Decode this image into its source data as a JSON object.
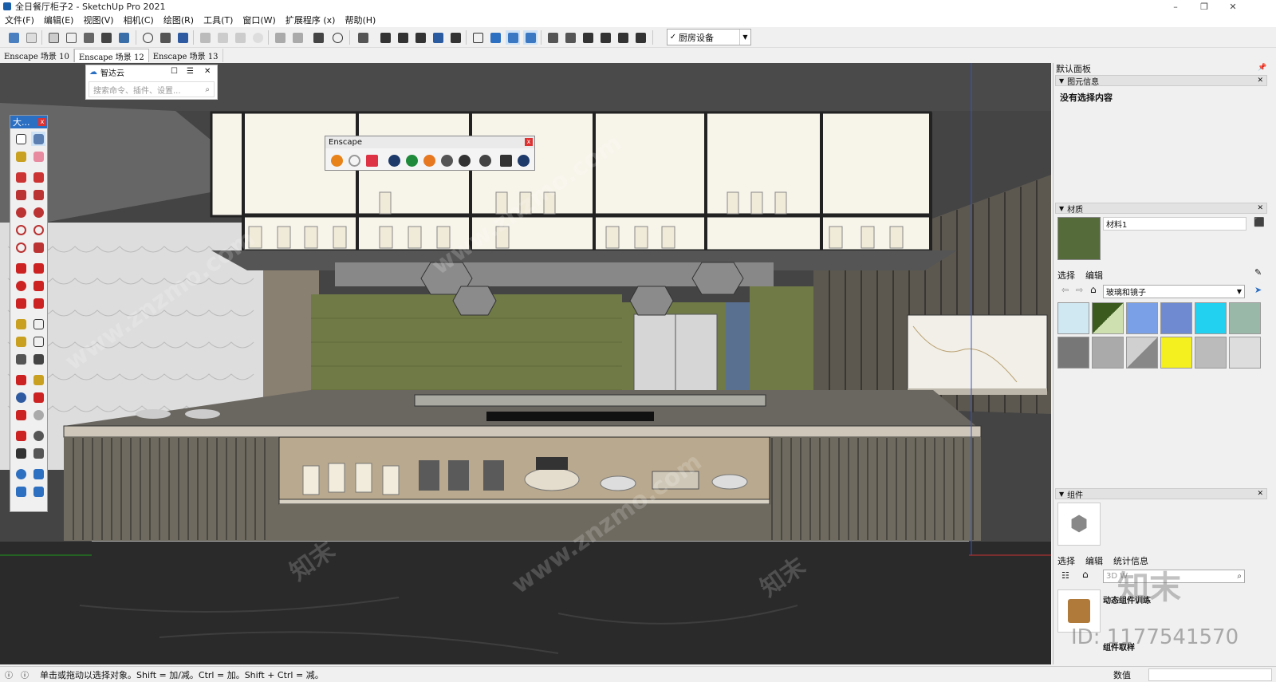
{
  "window": {
    "title": "全日餐厅柜子2 - SketchUp Pro 2021",
    "controls": [
      "–",
      "❐",
      "✕"
    ]
  },
  "menu": [
    "文件(F)",
    "编辑(E)",
    "视图(V)",
    "相机(C)",
    "绘图(R)",
    "工具(T)",
    "窗口(W)",
    "扩展程序 (x)",
    "帮助(H)"
  ],
  "toolbar": {
    "layer_value": "厨房设备",
    "layer_check": "✓"
  },
  "scene_tabs": [
    "Enscape 场景 10",
    "Enscape 场景 12",
    "Enscape 场景 13"
  ],
  "zhidayun": {
    "title": "智达云",
    "search_placeholder": "搜索命令、插件、设置..."
  },
  "large_toolset": {
    "title": "大..."
  },
  "enscape_toolbar": {
    "title": "Enscape"
  },
  "right_panel": {
    "title": "默认面板",
    "entity_info": {
      "header": "图元信息",
      "content": "没有选择内容"
    },
    "materials": {
      "header": "材质",
      "name": "材料1",
      "tab_select": "选择",
      "tab_edit": "编辑",
      "library": "玻璃和镜子"
    },
    "components": {
      "header": "组件",
      "tab_select": "选择",
      "tab_edit": "编辑",
      "tab_stats": "统计信息",
      "search_placeholder": "3D W",
      "item1": "动态组件训练",
      "item2": "组件取样"
    }
  },
  "status": {
    "text": "单击或拖动以选择对象。Shift = 加/减。Ctrl = 加。Shift + Ctrl = 减。",
    "measure_label": "数值"
  },
  "overlays": {
    "watermark": "知末",
    "id_text": "ID: 1177541570",
    "site": "www.znzmo.com"
  }
}
